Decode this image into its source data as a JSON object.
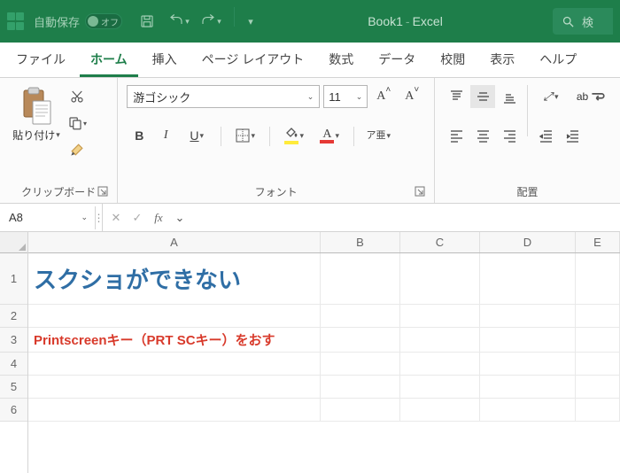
{
  "titlebar": {
    "autosave_label": "自動保存",
    "autosave_state": "オフ",
    "doc_name": "Book1",
    "app_name": "Excel",
    "search_placeholder": "検"
  },
  "tabs": [
    "ファイル",
    "ホーム",
    "挿入",
    "ページ レイアウト",
    "数式",
    "データ",
    "校閲",
    "表示",
    "ヘルプ"
  ],
  "active_tab": 1,
  "ribbon": {
    "clipboard": {
      "paste_label": "貼り付け",
      "group_label": "クリップボード"
    },
    "font": {
      "name": "游ゴシック",
      "size": "11",
      "group_label": "フォント",
      "ruby_label": "ア亜"
    },
    "align": {
      "ab_label": "ab",
      "group_label": "配置"
    }
  },
  "formula_bar": {
    "name_box": "A8",
    "formula": ""
  },
  "grid": {
    "columns": [
      "A",
      "B",
      "C",
      "D",
      "E"
    ],
    "row_numbers": [
      "1",
      "2",
      "3",
      "4",
      "5",
      "6"
    ],
    "cells": {
      "A1": "スクショができない",
      "A3": "Printscreenキー（PRT SCキー）をおす"
    }
  }
}
